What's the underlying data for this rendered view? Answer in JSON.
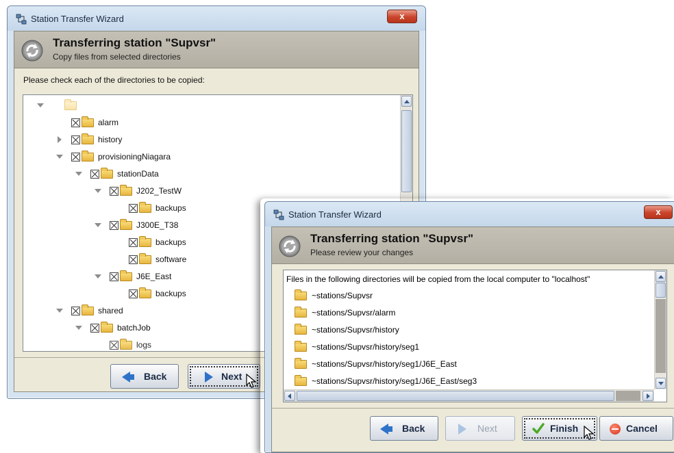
{
  "wizard1": {
    "window_title": "Station Transfer Wizard",
    "close_label": "x",
    "header_title": "Transferring station \"Supvsr\"",
    "header_subtitle": "Copy files from selected directories",
    "instruction": "Please check each of the directories to be copied:",
    "tree": [
      {
        "label": "",
        "expanded": true,
        "checked": false
      },
      {
        "label": "alarm",
        "checked": true
      },
      {
        "label": "history",
        "expanded": false,
        "checked": true
      },
      {
        "label": "provisioningNiagara",
        "expanded": true,
        "checked": true
      },
      {
        "label": "stationData",
        "expanded": true,
        "checked": true
      },
      {
        "label": "J202_TestW",
        "expanded": true,
        "checked": true
      },
      {
        "label": "backups",
        "checked": true
      },
      {
        "label": "J300E_T38",
        "expanded": true,
        "checked": true
      },
      {
        "label": "backups",
        "checked": true
      },
      {
        "label": "software",
        "checked": true
      },
      {
        "label": "J6E_East",
        "expanded": true,
        "checked": true
      },
      {
        "label": "backups",
        "checked": true
      },
      {
        "label": "shared",
        "expanded": true,
        "checked": true
      },
      {
        "label": "batchJob",
        "expanded": true,
        "checked": true
      },
      {
        "label": "logs",
        "checked": true
      }
    ],
    "buttons": {
      "back": "Back",
      "next": "Next"
    }
  },
  "wizard2": {
    "window_title": "Station Transfer Wizard",
    "close_label": "x",
    "header_title": "Transferring station \"Supvsr\"",
    "header_subtitle": "Please review your changes",
    "list_header": "Files in the following directories will be copied from the local computer to \"localhost\"",
    "items": [
      "~stations/Supvsr",
      "~stations/Supvsr/alarm",
      "~stations/Supvsr/history",
      "~stations/Supvsr/history/seg1",
      "~stations/Supvsr/history/seg1/J6E_East",
      "~stations/Supvsr/history/seg1/J6E_East/seg3"
    ],
    "buttons": {
      "back": "Back",
      "next": "Next",
      "finish": "Finish",
      "cancel": "Cancel"
    },
    "next_enabled": false
  },
  "colors": {
    "button_arrow": "#2f73c8",
    "close_button": "#c9442b",
    "folder": "#f0c95a"
  }
}
